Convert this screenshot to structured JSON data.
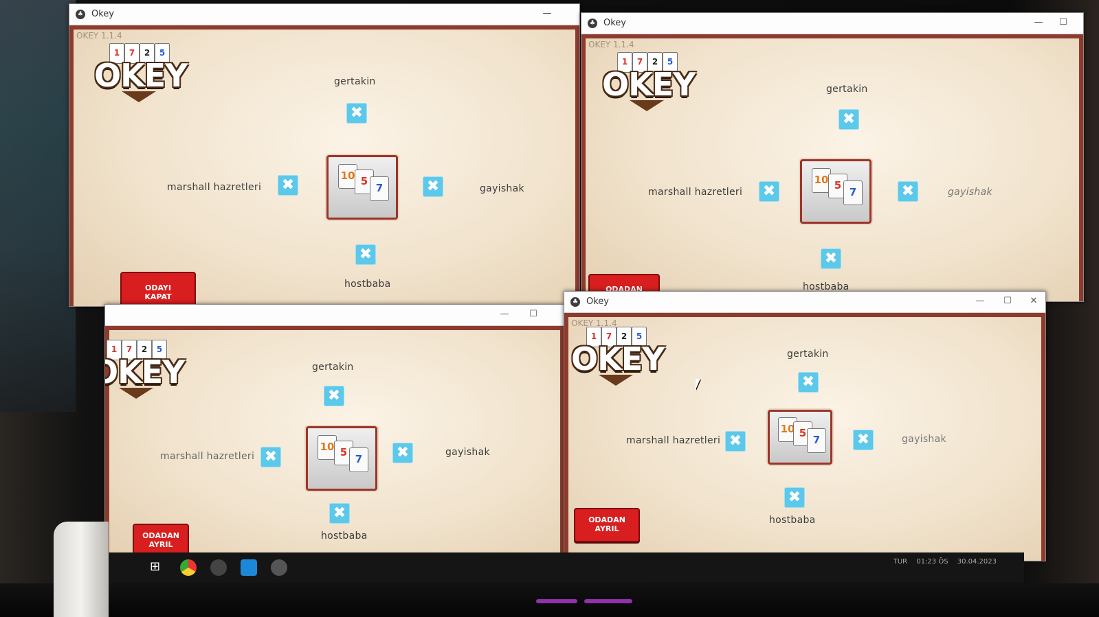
{
  "app": {
    "title": "Okey",
    "version": "OKEY 1.1.4",
    "logo_text": "OKEY",
    "logo_cards": [
      "1",
      "7",
      "2",
      "5"
    ],
    "deck_tiles": [
      "10",
      "5",
      "7"
    ]
  },
  "players": {
    "top": "gertakin",
    "left": "marshall hazretleri",
    "right": "gayishak",
    "bottom": "hostbaba"
  },
  "kick_button_glyph": "✖",
  "window_controls": {
    "minimize": "—",
    "maximize": "☐",
    "close": "✕"
  },
  "buttons": {
    "close_room": {
      "line1": "ODAYI",
      "line2": "KAPAT"
    },
    "leave_room": {
      "line1": "ODADAN",
      "line2": "AYRIL"
    }
  },
  "taskbar": {
    "start": "⊞",
    "lang": "TUR",
    "time": "01:23 ÖS",
    "date": "30.04.2023"
  },
  "colors": {
    "accent_blue": "#5cc8ea",
    "button_red": "#d81e1e",
    "frame_red": "#8e3b2e"
  }
}
